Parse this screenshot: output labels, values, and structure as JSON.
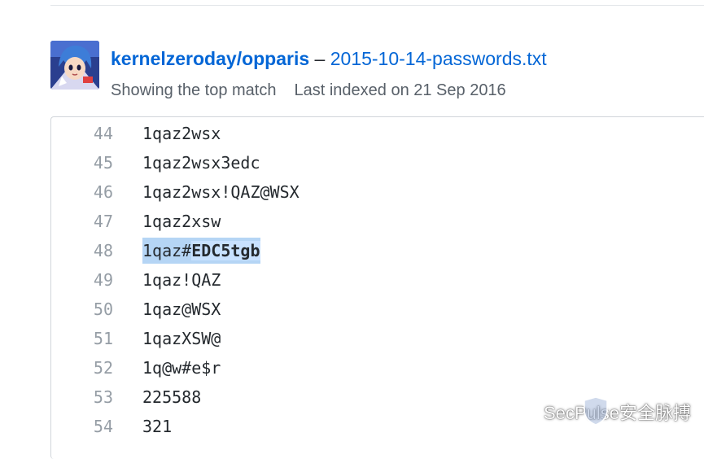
{
  "result": {
    "repo": "kernelzeroday/opparis",
    "separator": "–",
    "file": "2015-10-14-passwords.txt",
    "match_info": "Showing the top match",
    "indexed_info": "Last indexed on 21 Sep 2016"
  },
  "code": {
    "lines": [
      {
        "num": "44",
        "text": "1qaz2wsx"
      },
      {
        "num": "45",
        "text": "1qaz2wsx3edc"
      },
      {
        "num": "46",
        "text": "1qaz2wsx!QAZ@WSX"
      },
      {
        "num": "47",
        "text": "1qaz2xsw"
      },
      {
        "num": "48",
        "text_plain": "1qaz#",
        "text_bold": "EDC5tgb",
        "highlighted": true
      },
      {
        "num": "49",
        "text": "1qaz!QAZ"
      },
      {
        "num": "50",
        "text": "1qaz@WSX"
      },
      {
        "num": "51",
        "text": "1qazXSW@"
      },
      {
        "num": "52",
        "text": "1q@w#e$r"
      },
      {
        "num": "53",
        "text": "225588"
      },
      {
        "num": "54",
        "text": "321"
      }
    ]
  },
  "watermark": {
    "text": "SecPulse安全脉搏",
    "icon": "wechat-icon",
    "badge_text": "SECPULSE"
  },
  "colors": {
    "link": "#0366d6",
    "highlight": "#b5d5f5",
    "line_number": "#959da5"
  }
}
